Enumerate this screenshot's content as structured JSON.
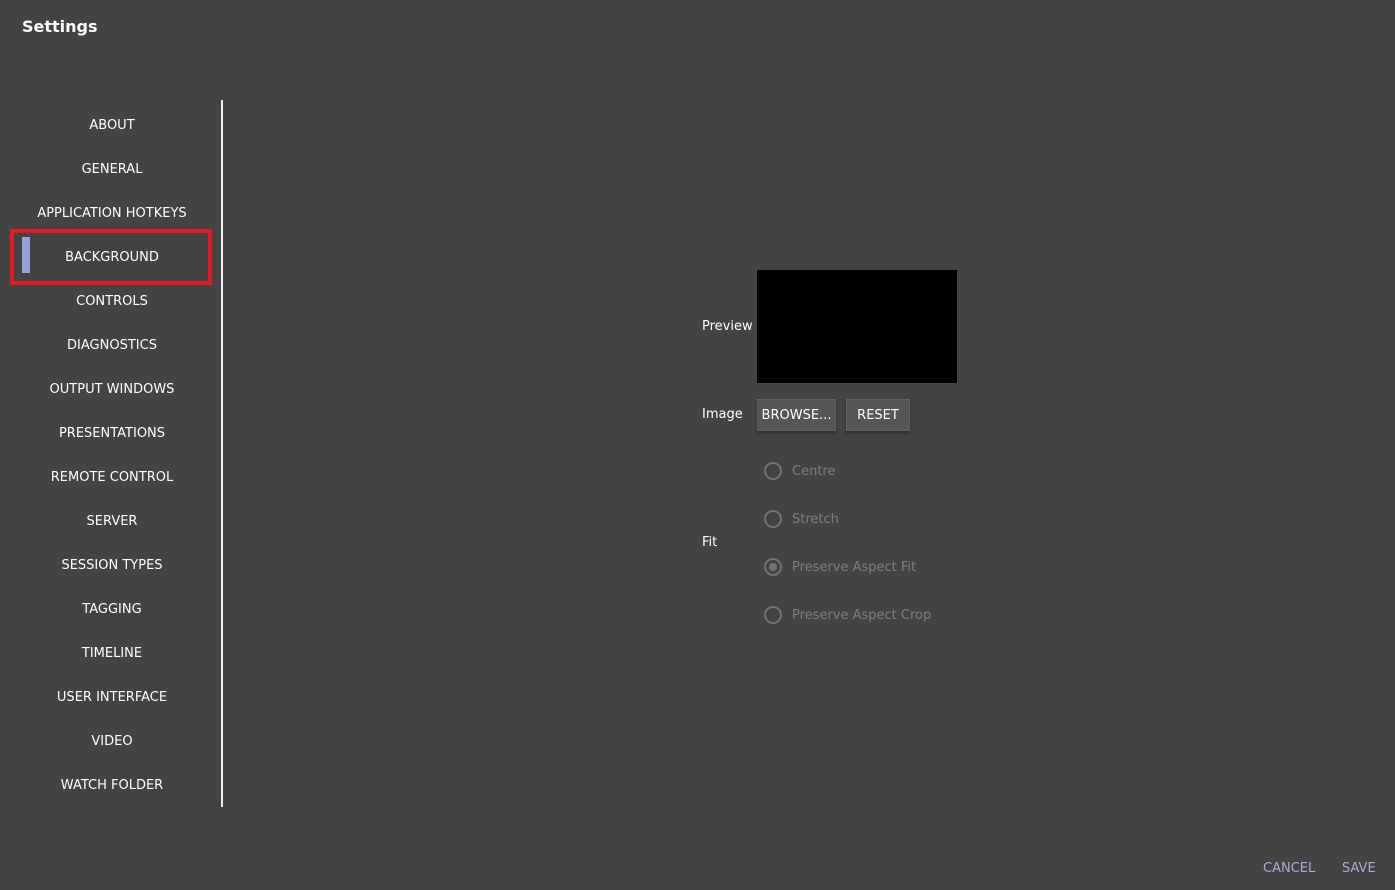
{
  "window": {
    "title": "Settings"
  },
  "sidebar": {
    "items": [
      {
        "label": "ABOUT"
      },
      {
        "label": "GENERAL"
      },
      {
        "label": "APPLICATION HOTKEYS"
      },
      {
        "label": "BACKGROUND",
        "selected": true
      },
      {
        "label": "CONTROLS"
      },
      {
        "label": "DIAGNOSTICS"
      },
      {
        "label": "OUTPUT WINDOWS"
      },
      {
        "label": "PRESENTATIONS"
      },
      {
        "label": "REMOTE CONTROL"
      },
      {
        "label": "SERVER"
      },
      {
        "label": "SESSION TYPES"
      },
      {
        "label": "TAGGING"
      },
      {
        "label": "TIMELINE"
      },
      {
        "label": "USER INTERFACE"
      },
      {
        "label": "VIDEO"
      },
      {
        "label": "WATCH FOLDER"
      }
    ]
  },
  "background": {
    "preview_label": "Preview",
    "image_label": "Image",
    "browse_label": "BROWSE...",
    "reset_label": "RESET",
    "fit_label": "Fit",
    "fit_options": [
      {
        "label": "Centre",
        "checked": false
      },
      {
        "label": "Stretch",
        "checked": false
      },
      {
        "label": "Preserve Aspect Fit",
        "checked": true
      },
      {
        "label": "Preserve Aspect Crop",
        "checked": false
      }
    ]
  },
  "footer": {
    "cancel_label": "CANCEL",
    "save_label": "SAVE"
  },
  "colors": {
    "background": "#434343",
    "accent": "#a7acde",
    "selection_bar": "#9aa0d8",
    "highlight_box": "#e01b24"
  }
}
